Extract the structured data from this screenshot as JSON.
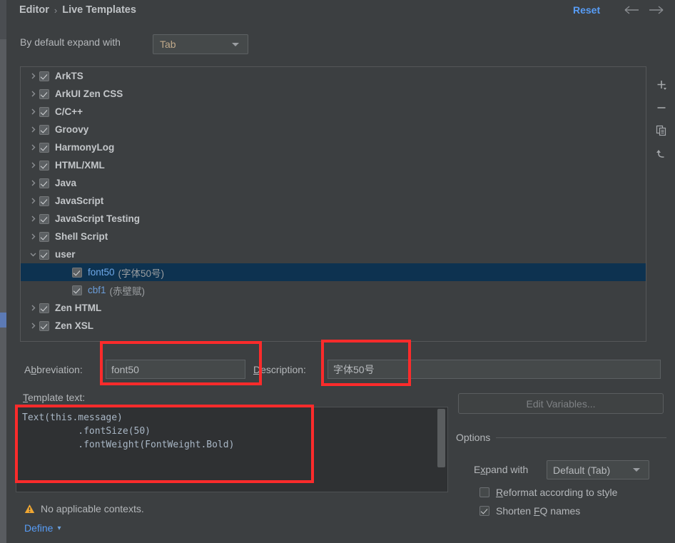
{
  "header": {
    "breadcrumb": [
      "Editor",
      "Live Templates"
    ],
    "separator": "›",
    "reset_label": "Reset",
    "back_icon": "arrow-left-icon",
    "forward_icon": "arrow-right-icon"
  },
  "default_expand": {
    "label": "By default expand with",
    "value": "Tab"
  },
  "tree": {
    "items": [
      {
        "label": "ArkTS",
        "checked": true,
        "expandable": true,
        "expanded": false,
        "child": false,
        "selected": false,
        "description": ""
      },
      {
        "label": "ArkUI Zen CSS",
        "checked": true,
        "expandable": true,
        "expanded": false,
        "child": false,
        "selected": false,
        "description": ""
      },
      {
        "label": "C/C++",
        "checked": true,
        "expandable": true,
        "expanded": false,
        "child": false,
        "selected": false,
        "description": ""
      },
      {
        "label": "Groovy",
        "checked": true,
        "expandable": true,
        "expanded": false,
        "child": false,
        "selected": false,
        "description": ""
      },
      {
        "label": "HarmonyLog",
        "checked": true,
        "expandable": true,
        "expanded": false,
        "child": false,
        "selected": false,
        "description": ""
      },
      {
        "label": "HTML/XML",
        "checked": true,
        "expandable": true,
        "expanded": false,
        "child": false,
        "selected": false,
        "description": ""
      },
      {
        "label": "Java",
        "checked": true,
        "expandable": true,
        "expanded": false,
        "child": false,
        "selected": false,
        "description": ""
      },
      {
        "label": "JavaScript",
        "checked": true,
        "expandable": true,
        "expanded": false,
        "child": false,
        "selected": false,
        "description": ""
      },
      {
        "label": "JavaScript Testing",
        "checked": true,
        "expandable": true,
        "expanded": false,
        "child": false,
        "selected": false,
        "description": ""
      },
      {
        "label": "Shell Script",
        "checked": true,
        "expandable": true,
        "expanded": false,
        "child": false,
        "selected": false,
        "description": ""
      },
      {
        "label": "user",
        "checked": true,
        "expandable": true,
        "expanded": true,
        "child": false,
        "selected": false,
        "description": ""
      },
      {
        "label": "font50",
        "checked": true,
        "expandable": false,
        "expanded": false,
        "child": true,
        "selected": true,
        "description": "(字体50号)"
      },
      {
        "label": "cbf1",
        "checked": true,
        "expandable": false,
        "expanded": false,
        "child": true,
        "selected": false,
        "description": "(赤壁赋)"
      },
      {
        "label": "Zen HTML",
        "checked": true,
        "expandable": true,
        "expanded": false,
        "child": false,
        "selected": false,
        "description": ""
      },
      {
        "label": "Zen XSL",
        "checked": true,
        "expandable": true,
        "expanded": false,
        "child": false,
        "selected": false,
        "description": ""
      }
    ]
  },
  "tree_toolbar": {
    "buttons": [
      {
        "name": "add-template-button",
        "icon": "plus-icon"
      },
      {
        "name": "remove-template-button",
        "icon": "minus-icon"
      },
      {
        "name": "duplicate-template-button",
        "icon": "copy-icon"
      },
      {
        "name": "revert-template-button",
        "icon": "undo-icon"
      }
    ]
  },
  "form": {
    "abbreviation_label": "Abbreviation:",
    "abbreviation_value": "font50",
    "description_label": "Description:",
    "description_value": "字体50号",
    "template_text_label": "Template text:",
    "template_text_value": "Text(this.message)\n          .fontSize(50)\n          .fontWeight(FontWeight.Bold)"
  },
  "options": {
    "edit_variables_label": "Edit Variables...",
    "title": "Options",
    "expand_with_label": "Expand with",
    "expand_with_value": "Default (Tab)",
    "reformat_label": "Reformat according to style",
    "reformat_checked": false,
    "shorten_label": "Shorten FQ names",
    "shorten_checked": true
  },
  "footer": {
    "warning_icon": "warning-triangle-icon",
    "warning_text": "No applicable contexts.",
    "define_label": "Define",
    "define_chevron": "⌄"
  },
  "colors": {
    "background": "#3c3f41",
    "accent_link": "#589df6",
    "selection": "#0d3250",
    "annotation": "#fc2b2b",
    "warning": "#f0a732",
    "tree_child_text": "#6a9cd8"
  }
}
